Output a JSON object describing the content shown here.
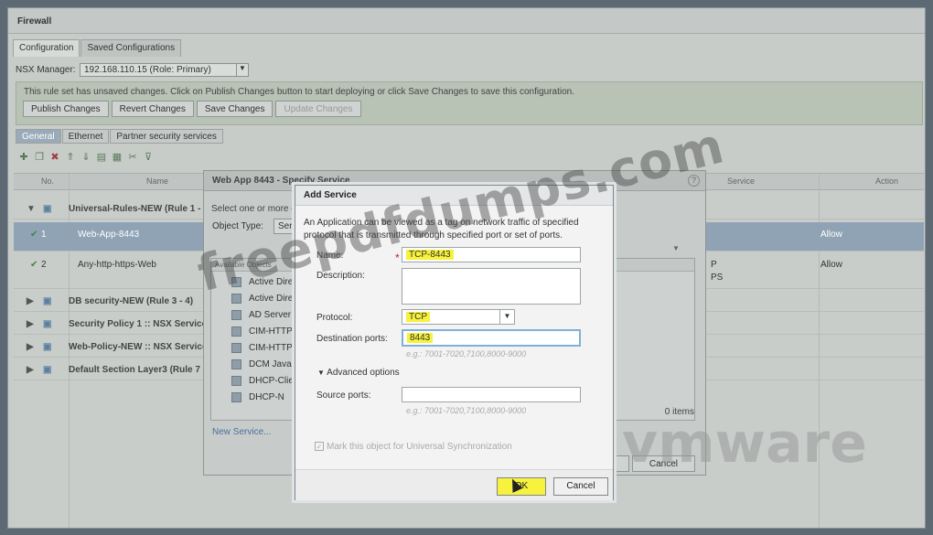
{
  "window": {
    "title": "Firewall"
  },
  "tabs": [
    {
      "label": "Configuration"
    },
    {
      "label": "Saved Configurations"
    }
  ],
  "nsx_manager": {
    "label": "NSX Manager:",
    "value": "192.168.110.15 (Role: Primary)"
  },
  "warning": {
    "message": "This rule set has unsaved changes. Click on Publish Changes button to start deploying or click Save Changes to save this configuration.",
    "buttons": [
      "Publish Changes",
      "Revert Changes",
      "Save Changes",
      "Update Changes"
    ]
  },
  "subtabs": [
    "General",
    "Ethernet",
    "Partner security services"
  ],
  "grid": {
    "headers": {
      "no": "No.",
      "name": "Name",
      "service": "Service",
      "action": "Action"
    },
    "rows": [
      {
        "no": "",
        "name": "Universal-Rules-NEW (Rule 1 - 2)",
        "action": ""
      },
      {
        "no": "1",
        "name": "Web-App-8443",
        "action": "Allow"
      },
      {
        "no": "2",
        "name": "Any-http-https-Web",
        "action": "Allow"
      },
      {
        "no": "",
        "name": "DB security-NEW (Rule 3 - 4)",
        "action": ""
      },
      {
        "no": "",
        "name": "Security Policy 1 :: NSX Service C",
        "action": ""
      },
      {
        "no": "",
        "name": "Web-Policy-NEW :: NSX Service",
        "action": ""
      },
      {
        "no": "",
        "name": "Default Section Layer3 (Rule 7 - 1",
        "action": ""
      }
    ],
    "service_snippets": [
      "P",
      "PS"
    ]
  },
  "specify_service": {
    "title": "Web App 8443 - Specify Service",
    "select_text": "Select one or more o",
    "object_type_label": "Object Type:",
    "object_type_value": "Ser",
    "available_header": "Available Objects",
    "items": [
      "Active Direc",
      "Active Direc",
      "AD Server",
      "CIM-HTTP",
      "CIM-HTTPS",
      "DCM Java",
      "DHCP-Clie",
      "DHCP-N"
    ],
    "count": "0 items",
    "new_service": "New Service...",
    "ok": "OK",
    "cancel": "Cancel"
  },
  "add_service": {
    "title": "Add Service",
    "info": "An Application can be viewed as a tag on network traffic of specified protocol that is transmitted through specified port or set of ports.",
    "name_label": "Name:",
    "name_value": "TCP-8443",
    "description_label": "Description:",
    "protocol_label": "Protocol:",
    "protocol_value": "TCP",
    "dest_label": "Destination ports:",
    "dest_value": "8443",
    "dest_hint": "e.g.: 7001-7020,7100,8000-9000",
    "advanced": "Advanced options",
    "source_label": "Source ports:",
    "source_value": "",
    "source_hint": "e.g.: 7001-7020,7100,8000-9000",
    "universal_sync": "Mark this object for Universal Synchronization",
    "ok": "OK",
    "cancel": "Cancel"
  },
  "watermarks": {
    "site": "freepdfdumps.com",
    "brand": "vmware"
  }
}
